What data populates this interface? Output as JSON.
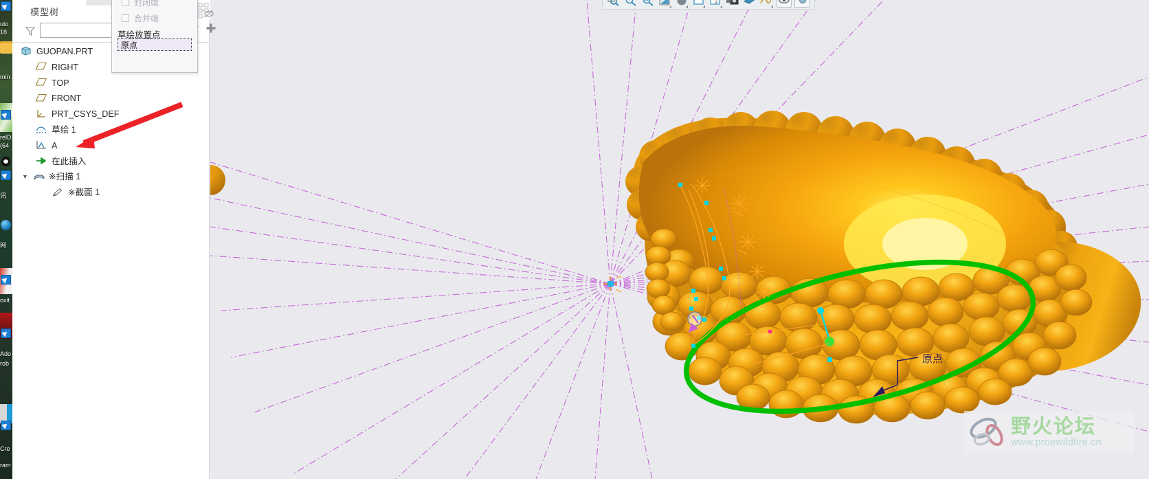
{
  "window": {
    "app_background": "#eaeaee",
    "panel_background": "#ffffff"
  },
  "desktop": {
    "items": [
      {
        "label": "uto"
      },
      {
        "label": "18"
      },
      {
        "label": "min"
      },
      {
        "label": "relD"
      },
      {
        "label": "(64"
      },
      {
        "label": "讯"
      },
      {
        "label": "网"
      },
      {
        "label": "oxit"
      },
      {
        "label": "Ado"
      },
      {
        "label": "rob"
      },
      {
        "label": "Cre"
      },
      {
        "label": "ram"
      }
    ]
  },
  "tree": {
    "title": "模型树",
    "filter_value": "",
    "filter_placeholder": "",
    "filter_icon": "funnel-icon",
    "settings_icon": "tree-filter-icon",
    "add_icon": "plus-icon",
    "nodes": [
      {
        "label": "GUOPAN.PRT",
        "icon": "part-icon",
        "indent": 0,
        "expander": ""
      },
      {
        "label": "RIGHT",
        "icon": "plane-icon",
        "indent": 1,
        "expander": ""
      },
      {
        "label": "TOP",
        "icon": "plane-icon",
        "indent": 1,
        "expander": ""
      },
      {
        "label": "FRONT",
        "icon": "plane-icon",
        "indent": 1,
        "expander": ""
      },
      {
        "label": "PRT_CSYS_DEF",
        "icon": "csys-icon",
        "indent": 1,
        "expander": ""
      },
      {
        "label": "草绘 1",
        "icon": "sketch-icon",
        "indent": 1,
        "expander": ""
      },
      {
        "label": "A",
        "icon": "curve-icon",
        "indent": 1,
        "expander": ""
      },
      {
        "label": "在此插入",
        "icon": "insert-here-icon",
        "indent": 1,
        "expander": ""
      },
      {
        "label": "※扫描 1",
        "icon": "sweep-icon",
        "indent": 1,
        "expander": "▼"
      },
      {
        "label": "※截面 1",
        "icon": "section-icon",
        "indent": 2,
        "expander": ""
      }
    ]
  },
  "dialog": {
    "checkboxes": [
      {
        "label": "封闭端",
        "checked": false,
        "disabled": true
      },
      {
        "label": "合并端",
        "checked": false,
        "disabled": true
      }
    ],
    "field_label": "草绘放置点",
    "field_value": "原点"
  },
  "toolbar": {
    "buttons": [
      {
        "name": "zoom-in-icon",
        "framed": false,
        "dropdown": false
      },
      {
        "name": "zoom-out-icon",
        "framed": false,
        "dropdown": false
      },
      {
        "name": "refit-zoom-icon",
        "framed": false,
        "dropdown": false
      },
      {
        "name": "display-style-icon",
        "framed": false,
        "dropdown": true
      },
      {
        "name": "shading-sphere-icon",
        "framed": false,
        "dropdown": true
      },
      {
        "name": "datum-display-icon",
        "framed": false,
        "dropdown": true
      },
      {
        "name": "annotation-display-icon",
        "framed": false,
        "dropdown": true
      },
      {
        "name": "saved-view-icon",
        "framed": false,
        "dropdown": false
      },
      {
        "name": "appearance-icon",
        "framed": false,
        "dropdown": false
      },
      {
        "name": "curve-display-icon",
        "framed": false,
        "dropdown": true
      },
      {
        "name": "visibility-eye-icon",
        "framed": true,
        "dropdown": false
      },
      {
        "name": "color-swatch-icon",
        "framed": true,
        "dropdown": false
      }
    ]
  },
  "viewport": {
    "annotation_label": "原点",
    "model_name": "GUOPAN",
    "colors": {
      "background": "#eaeaee",
      "model_gold": "#f0a018",
      "model_highlight": "#ffe45c",
      "model_shadow": "#b5740a",
      "trajectory_green": "#00c000",
      "datum_purple": "#c060d0",
      "sketch_orange": "#ffa520",
      "handle_cyan": "#00d8e8",
      "annotation_navy": "#2a1a5e",
      "arrow_red": "#ec2228"
    }
  },
  "watermark": {
    "title": "野火论坛",
    "url": "www.proewildfire.cn"
  }
}
